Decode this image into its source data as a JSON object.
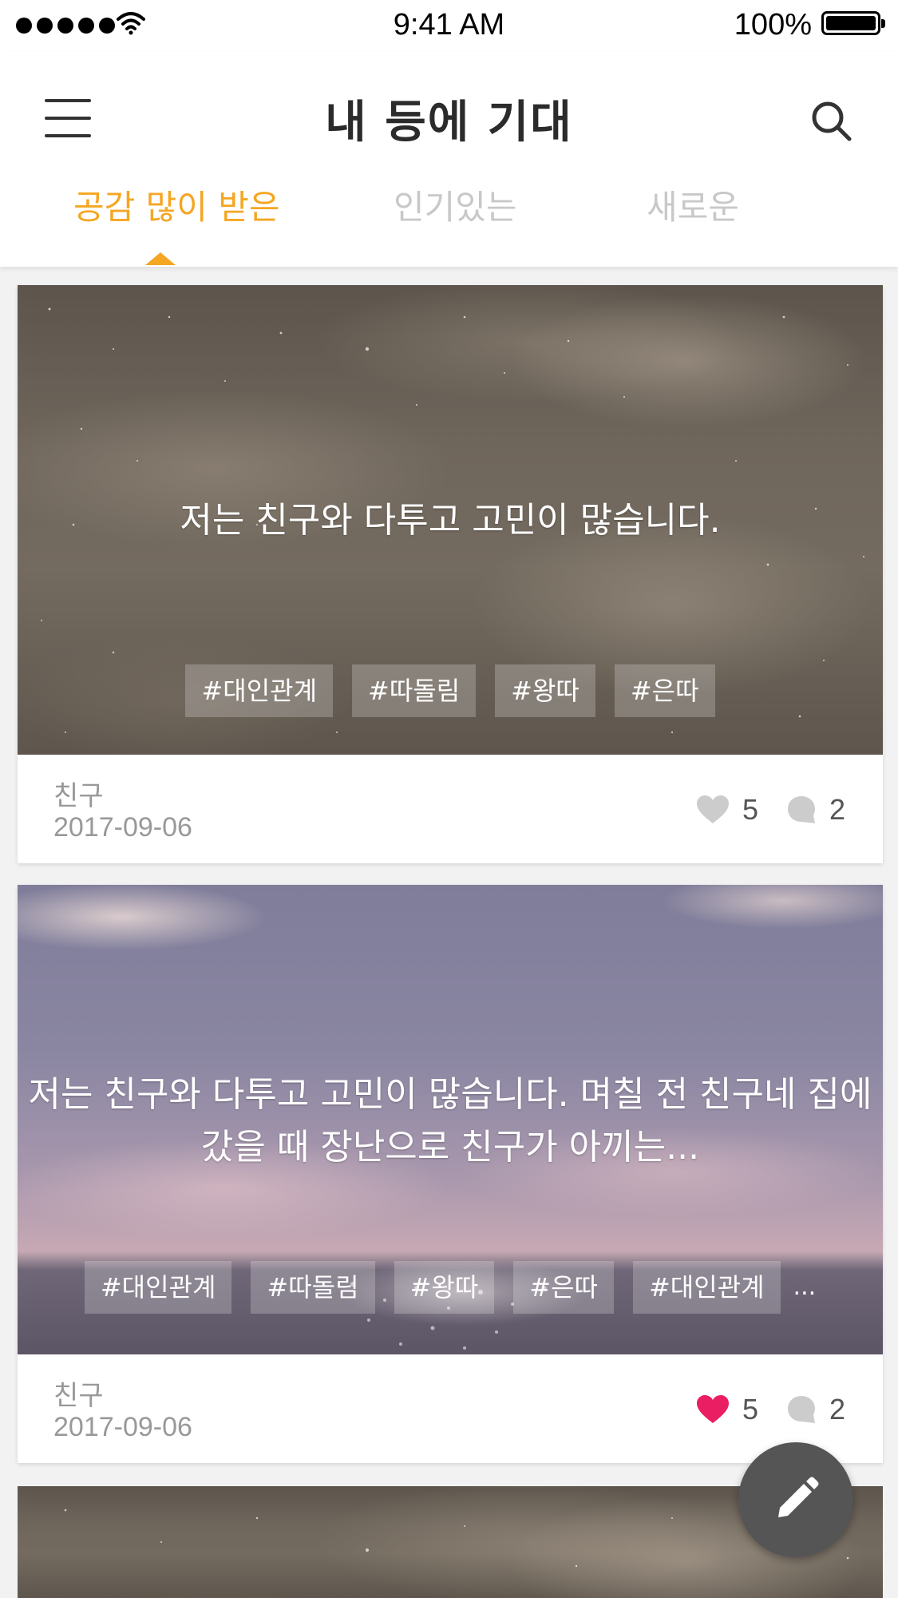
{
  "status_bar": {
    "time": "9:41 AM",
    "battery": "100%",
    "signal_icon": "signal-dots-icon",
    "wifi_icon": "wifi-icon",
    "battery_icon": "battery-icon"
  },
  "header": {
    "title": "내 등에 기대",
    "menu_icon": "hamburger-menu-icon",
    "search_icon": "search-icon"
  },
  "tabs": [
    {
      "label": "공감 많이 받은",
      "active": true
    },
    {
      "label": "인기있는",
      "active": false
    },
    {
      "label": "새로운",
      "active": false
    }
  ],
  "colors": {
    "accent": "#f5a623",
    "liked": "#e91e63",
    "inactive_tab": "#c8c8c8",
    "fab": "#555555"
  },
  "posts": [
    {
      "text": "저는 친구와 다투고 고민이 많습니다.",
      "tags": [
        "#대인관계",
        "#따돌림",
        "#왕따",
        "#은따"
      ],
      "author": "친구",
      "date": "2017-09-06",
      "likes": "5",
      "liked": false,
      "comments": "2"
    },
    {
      "text": "저는 친구와 다투고 고민이 많습니다. 며칠 전 친구네 집에 갔을 때 장난으로 친구가 아끼는...",
      "tags": [
        "#대인관계",
        "#따돌림",
        "#왕따",
        "#은따",
        "#대인관계"
      ],
      "more": "...",
      "author": "친구",
      "date": "2017-09-06",
      "likes": "5",
      "liked": true,
      "comments": "2"
    }
  ],
  "fab": {
    "icon": "pencil-icon"
  }
}
